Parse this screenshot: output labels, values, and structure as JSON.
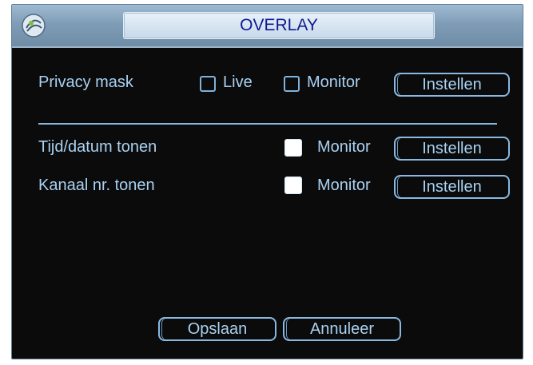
{
  "window": {
    "title": "OVERLAY"
  },
  "privacy_mask": {
    "label": "Privacy mask",
    "live_label": "Live",
    "monitor_label": "Monitor",
    "live_checked": false,
    "monitor_checked": false,
    "settings_button": "Instellen"
  },
  "time_date": {
    "label": "Tijd/datum tonen",
    "monitor_label": "Monitor",
    "monitor_checked": true,
    "settings_button": "Instellen"
  },
  "channel_number": {
    "label": "Kanaal nr. tonen",
    "monitor_label": "Monitor",
    "monitor_checked": true,
    "settings_button": "Instellen"
  },
  "footer": {
    "save_button": "Opslaan",
    "cancel_button": "Annuleer"
  },
  "colors": {
    "background": "#0b0b0b",
    "text": "#a9d1f2",
    "accent": "#8ab8e0",
    "title_text": "#111a8f"
  },
  "icons": {
    "logo": "dvr-logo-icon"
  }
}
